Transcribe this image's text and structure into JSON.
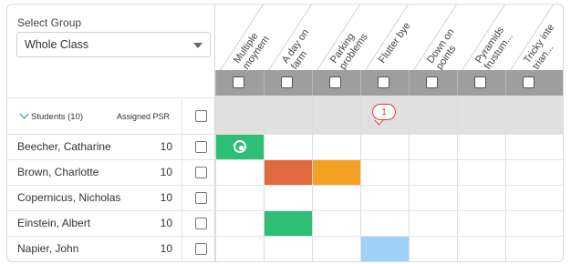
{
  "group_selector": {
    "label": "Select Group",
    "value": "Whole Class"
  },
  "students_header": {
    "label": "Students (10)",
    "psr_label": "Assigned PSR"
  },
  "columns": [
    {
      "line1": "Multiple",
      "line2": "moynem"
    },
    {
      "line1": "A day on",
      "line2": "farm"
    },
    {
      "line1": "Parking",
      "line2": "problems"
    },
    {
      "line1": "Flutter bye",
      "line2": ""
    },
    {
      "line1": "Down on",
      "line2": "points"
    },
    {
      "line1": "Pyramids",
      "line2": "frustum..."
    },
    {
      "line1": "Tricky inte",
      "line2": "trian..."
    }
  ],
  "summary": {
    "comment_count": "1",
    "comment_column": 3
  },
  "students": [
    {
      "name": "Beecher, Catharine",
      "psr": "10"
    },
    {
      "name": "Brown, Charlotte",
      "psr": "10"
    },
    {
      "name": "Copernicus, Nicholas",
      "psr": "10"
    },
    {
      "name": "Einstein, Albert",
      "psr": "10"
    },
    {
      "name": "Napier, John",
      "psr": "10"
    }
  ],
  "cells": [
    {
      "row": 0,
      "col": 0,
      "color": "#2dbf75",
      "icon": "target-icon"
    },
    {
      "row": 1,
      "col": 1,
      "color": "#e06a3d"
    },
    {
      "row": 1,
      "col": 2,
      "color": "#f4a020"
    },
    {
      "row": 3,
      "col": 1,
      "color": "#2dbf75"
    },
    {
      "row": 4,
      "col": 3,
      "color": "#9fd0f7"
    }
  ]
}
